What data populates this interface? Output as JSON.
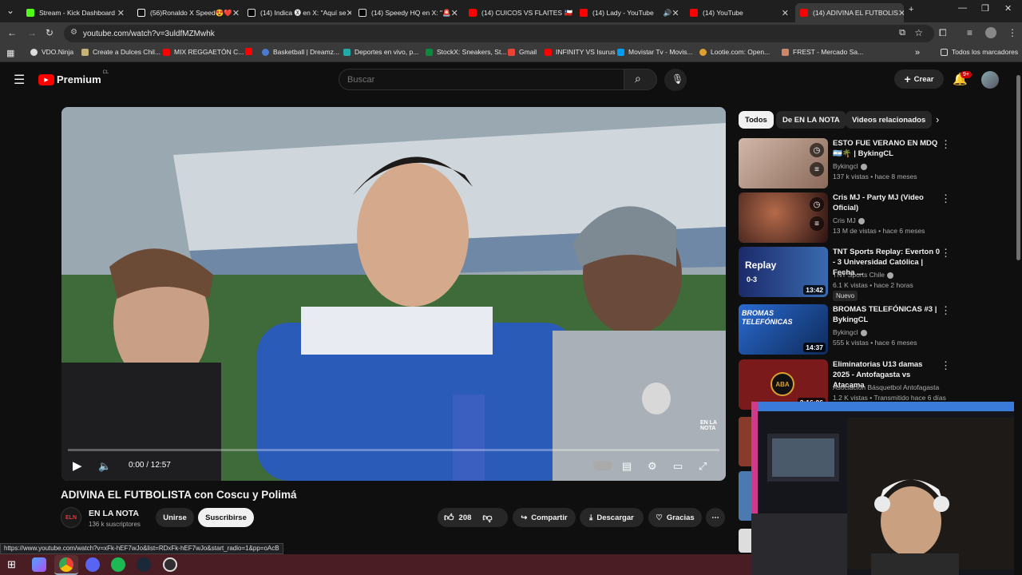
{
  "browser": {
    "tabs": [
      {
        "title": "Stream - Kick Dashboard",
        "color": "#53fc18"
      },
      {
        "title": "(56)Ronaldo X Speed😍❤️",
        "color": "#ffffff"
      },
      {
        "title": "(14) Indica 🅧 en X: \"Aquí se",
        "color": "#ffffff"
      },
      {
        "title": "(14) Speedy HQ en X: \"🚨",
        "color": "#ffffff"
      },
      {
        "title": "(14) CUICOS VS FLAITES 🇨🇱",
        "color": "#ff0000"
      },
      {
        "title": "(14) Lady - YouTube",
        "color": "#ff0000"
      },
      {
        "title": "(14) YouTube",
        "color": "#ff0000"
      },
      {
        "title": "(14) ADIVINA EL FUTBOLIS",
        "color": "#ff0000"
      }
    ],
    "url": "youtube.com/watch?v=3uldfMZMwhk",
    "bookmarks": [
      {
        "label": "VDO.Ninja",
        "color": "#dddddd"
      },
      {
        "label": "Create a Dulces Chil...",
        "color": "#c8b27a"
      },
      {
        "label": "MIX REGGAETÓN C...",
        "color": "#ff0000"
      },
      {
        "label": "",
        "color": "#ff0000"
      },
      {
        "label": "Basketball | Dreamz...",
        "color": "#4a7bd0"
      },
      {
        "label": "Deportes en vivo, p...",
        "color": "#2aa"
      },
      {
        "label": "StockX: Sneakers, St...",
        "color": "#0a8a3a"
      },
      {
        "label": "Gmail",
        "color": "#ea4335"
      },
      {
        "label": "INFINITY VS Isurus",
        "color": "#ff0000"
      },
      {
        "label": "Movistar Tv - Movis...",
        "color": "#019df4"
      },
      {
        "label": "Lootie.com: Open...",
        "color": "#e0a030"
      },
      {
        "label": "FREST - Mercado Sa...",
        "color": "#c86"
      }
    ],
    "all_bookmarks": "Todos los marcadores",
    "status_url": "https://www.youtube.com/watch?v=xFk-hEF7wJo&list=RDxFk-hEF7wJo&start_radio=1&pp=oAcB"
  },
  "youtube": {
    "logo": "Premium",
    "region": "CL",
    "search_placeholder": "Buscar",
    "create_label": "Crear",
    "notif_count": "9+",
    "player": {
      "time": "0:00 / 12:57",
      "progress": 0,
      "watermark": "EN LA NOTA"
    },
    "video_title": "ADIVINA EL FUTBOLISTA con Coscu y Polimá",
    "channel": {
      "name": "EN LA NOTA",
      "subs": "136 k suscriptores",
      "join": "Unirse",
      "subscribe": "Suscribirse"
    },
    "actions": {
      "likes": "208",
      "share": "Compartir",
      "download": "Descargar",
      "thanks": "Gracias"
    },
    "chips": [
      "Todos",
      "De EN LA NOTA",
      "Videos relacionados"
    ],
    "recommendations": [
      {
        "title": "ESTO FUE VERANO EN MDQ 🇦🇷🌴 | BykingCL",
        "channel": "Bykingcl",
        "meta": "137 k vistas • hace 8 meses",
        "duration": "",
        "thumb": "#b89a8a"
      },
      {
        "title": "Cris MJ - Party MJ (Video Oficial)",
        "channel": "Cris MJ",
        "meta": "13 M de vistas • hace 6 meses",
        "duration": "",
        "thumb": "#5a2a2a"
      },
      {
        "title": "TNT Sports Replay: Everton 0 - 3 Universidad Católica | Fecha ...",
        "channel": "TNT Sports Chile",
        "meta": "6.1 K vistas • hace 2 horas",
        "duration": "13:42",
        "badge": "Nuevo",
        "thumb": "#2a3a7a"
      },
      {
        "title": "BROMAS TELEFÓNICAS #3 | BykingCL",
        "channel": "Bykingcl",
        "meta": "555 k vistas • hace 6 meses",
        "duration": "14:37",
        "thumb": "#2a5aa0"
      },
      {
        "title": "Eliminatorias U13 damas 2025 - Antofagasta vs Atacama",
        "channel": "Asociación Básquetbol Antofagasta",
        "meta": "1.2 K vistas • Transmitido hace 6 días",
        "duration": "2:16:06",
        "thumb": "#7a1a1a"
      }
    ],
    "thumb_texts": {
      "replay": "Replay",
      "score": "0-3",
      "bromas": "BROMAS TELEFÓNICAS",
      "aba": "ABA"
    }
  }
}
